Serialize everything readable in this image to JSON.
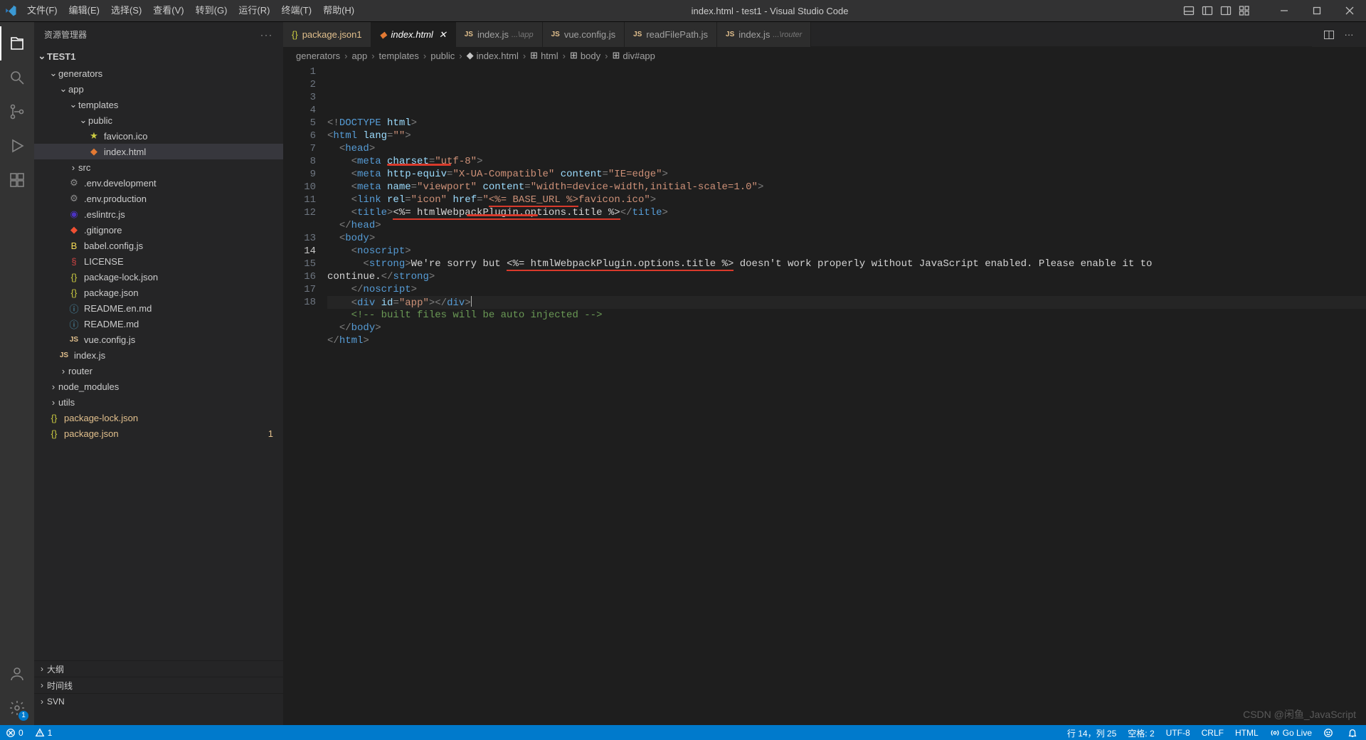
{
  "title_bar": {
    "menus": [
      "文件(F)",
      "编辑(E)",
      "选择(S)",
      "查看(V)",
      "转到(G)",
      "运行(R)",
      "终端(T)",
      "帮助(H)"
    ],
    "title": "index.html - test1 - Visual Studio Code"
  },
  "sidebar": {
    "header": "资源管理器",
    "root": "TEST1",
    "tree": [
      {
        "depth": 1,
        "kind": "folder-open",
        "label": "generators"
      },
      {
        "depth": 2,
        "kind": "folder-open",
        "label": "app"
      },
      {
        "depth": 3,
        "kind": "folder-open",
        "label": "templates"
      },
      {
        "depth": 4,
        "kind": "folder-open",
        "label": "public"
      },
      {
        "depth": 5,
        "kind": "star",
        "label": "favicon.ico"
      },
      {
        "depth": 5,
        "kind": "html",
        "label": "index.html",
        "selected": true
      },
      {
        "depth": 3,
        "kind": "folder",
        "label": "src"
      },
      {
        "depth": 3,
        "kind": "gear",
        "label": ".env.development"
      },
      {
        "depth": 3,
        "kind": "gear",
        "label": ".env.production"
      },
      {
        "depth": 3,
        "kind": "eslint",
        "label": ".eslintrc.js"
      },
      {
        "depth": 3,
        "kind": "git",
        "label": ".gitignore"
      },
      {
        "depth": 3,
        "kind": "babel",
        "label": "babel.config.js"
      },
      {
        "depth": 3,
        "kind": "license",
        "label": "LICENSE"
      },
      {
        "depth": 3,
        "kind": "json",
        "label": "package-lock.json"
      },
      {
        "depth": 3,
        "kind": "json",
        "label": "package.json"
      },
      {
        "depth": 3,
        "kind": "md",
        "label": "README.en.md"
      },
      {
        "depth": 3,
        "kind": "md",
        "label": "README.md"
      },
      {
        "depth": 3,
        "kind": "js",
        "label": "vue.config.js"
      },
      {
        "depth": 2,
        "kind": "js",
        "label": "index.js"
      },
      {
        "depth": 2,
        "kind": "folder",
        "label": "router"
      },
      {
        "depth": 1,
        "kind": "folder",
        "label": "node_modules"
      },
      {
        "depth": 1,
        "kind": "folder",
        "label": "utils"
      },
      {
        "depth": 1,
        "kind": "json",
        "label": "package-lock.json",
        "modified": true
      },
      {
        "depth": 1,
        "kind": "json",
        "label": "package.json",
        "modified": true,
        "badge": "1"
      }
    ],
    "bottom_sections": [
      "大纲",
      "时间线",
      "SVN"
    ]
  },
  "tabs": [
    {
      "icon": "json",
      "label": "package.json",
      "dim": "",
      "mark": "1",
      "modified": true
    },
    {
      "icon": "html",
      "label": "index.html",
      "active": true,
      "close": true
    },
    {
      "icon": "js",
      "label": "index.js",
      "dim": "...\\app"
    },
    {
      "icon": "js",
      "label": "vue.config.js"
    },
    {
      "icon": "js",
      "label": "readFilePath.js"
    },
    {
      "icon": "js",
      "label": "index.js",
      "dim": "...\\router"
    }
  ],
  "breadcrumbs": [
    "generators",
    "app",
    "templates",
    "public",
    "index.html",
    "html",
    "body",
    "div#app"
  ],
  "code": {
    "lines": 18
  },
  "status_bar": {
    "errors": "0",
    "warnings": "1",
    "cursor": "行 14，列 25",
    "spaces": "空格: 2",
    "encoding": "UTF-8",
    "eol": "CRLF",
    "lang": "HTML",
    "golive": "Go Live"
  },
  "gear_badge": "1",
  "watermark": "CSDN @闲鱼_JavaScript"
}
